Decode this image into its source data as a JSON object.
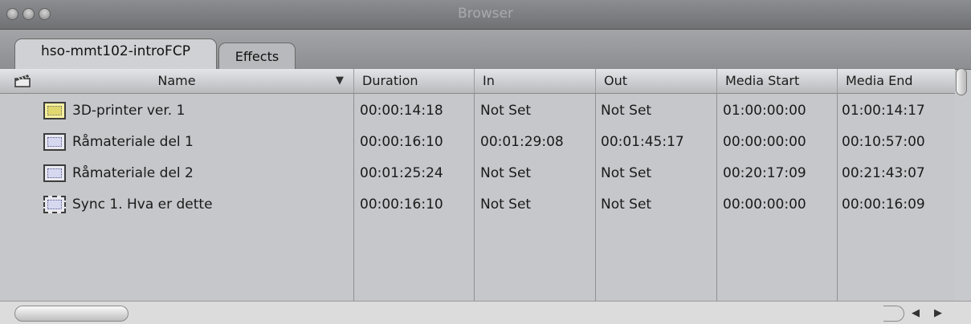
{
  "window": {
    "title": "Browser"
  },
  "tabs": [
    {
      "label": "hso-mmt102-introFCP",
      "active": true
    },
    {
      "label": "Effects",
      "active": false
    }
  ],
  "columns": {
    "name": "Name",
    "duration": "Duration",
    "in": "In",
    "out": "Out",
    "media_start": "Media Start",
    "media_end": "Media End"
  },
  "rows": [
    {
      "icon": "sequence-icon",
      "name": "3D-printer ver. 1",
      "duration": "00:00:14:18",
      "in": "Not Set",
      "out": "Not Set",
      "media_start": "01:00:00:00",
      "media_end": "01:00:14:17"
    },
    {
      "icon": "clip-icon",
      "name": "Råmateriale del 1",
      "duration": "00:00:16:10",
      "in": "00:01:29:08",
      "out": "00:01:45:17",
      "media_start": "00:00:00:00",
      "media_end": "00:10:57:00"
    },
    {
      "icon": "clip-icon",
      "name": "Råmateriale del 2",
      "duration": "00:01:25:24",
      "in": "Not Set",
      "out": "Not Set",
      "media_start": "00:20:17:09",
      "media_end": "00:21:43:07"
    },
    {
      "icon": "sync-clip-icon",
      "name": "Sync 1. Hva er dette",
      "duration": "00:00:16:10",
      "in": "Not Set",
      "out": "Not Set",
      "media_start": "00:00:00:00",
      "media_end": "00:00:16:09"
    }
  ],
  "icons": {
    "sort": "sort-down-icon",
    "scroll_left": "scroll-left-icon",
    "scroll_right": "scroll-right-icon",
    "header_clapper": "clapperboard-icon"
  }
}
